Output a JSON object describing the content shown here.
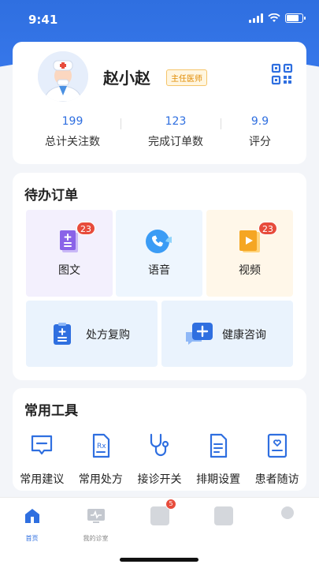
{
  "status_bar": {
    "time": "9:41"
  },
  "profile": {
    "name": "赵小赵",
    "title_badge": "主任医师",
    "qr_icon": "qr-code-icon",
    "stats": [
      {
        "value": "199",
        "label": "总计关注数"
      },
      {
        "value": "123",
        "label": "完成订单数"
      },
      {
        "value": "9.9",
        "label": "评分"
      }
    ]
  },
  "todo": {
    "title": "待办订单",
    "tiles": [
      {
        "label": "图文",
        "badge": "23",
        "icon": "document-icon",
        "bg": "#f3f0fd"
      },
      {
        "label": "语音",
        "badge": "",
        "icon": "phone-call-icon",
        "bg": "#eef6fe"
      },
      {
        "label": "视频",
        "badge": "23",
        "icon": "video-icon",
        "bg": "#fff7e9"
      },
      {
        "label": "处方复购",
        "icon": "prescription-icon",
        "bg": "#eaf3fd"
      },
      {
        "label": "健康咨询",
        "icon": "chat-plus-icon",
        "bg": "#eaf3fd"
      }
    ]
  },
  "tools": {
    "title": "常用工具",
    "items": [
      {
        "label": "常用建议",
        "icon": "message-icon"
      },
      {
        "label": "常用处方",
        "icon": "rx-icon"
      },
      {
        "label": "接诊开关",
        "icon": "stethoscope-icon"
      },
      {
        "label": "排期设置",
        "icon": "schedule-icon"
      },
      {
        "label": "患者随访",
        "icon": "heart-card-icon"
      }
    ]
  },
  "tabbar": {
    "tabs": [
      {
        "label": "首页",
        "icon": "home-icon",
        "active": true
      },
      {
        "label": "我的诊室",
        "icon": "monitor-icon",
        "active": false
      },
      {
        "label": "",
        "icon": "message-tab-icon",
        "badge": "5",
        "active": false
      },
      {
        "label": "",
        "icon": "grid-tab-icon",
        "active": false
      },
      {
        "label": "",
        "icon": "profile-tab-icon",
        "active": false
      }
    ]
  },
  "colors": {
    "primary": "#2f6fe0",
    "badge": "#e74c3c",
    "title_badge": "#e08a00"
  }
}
